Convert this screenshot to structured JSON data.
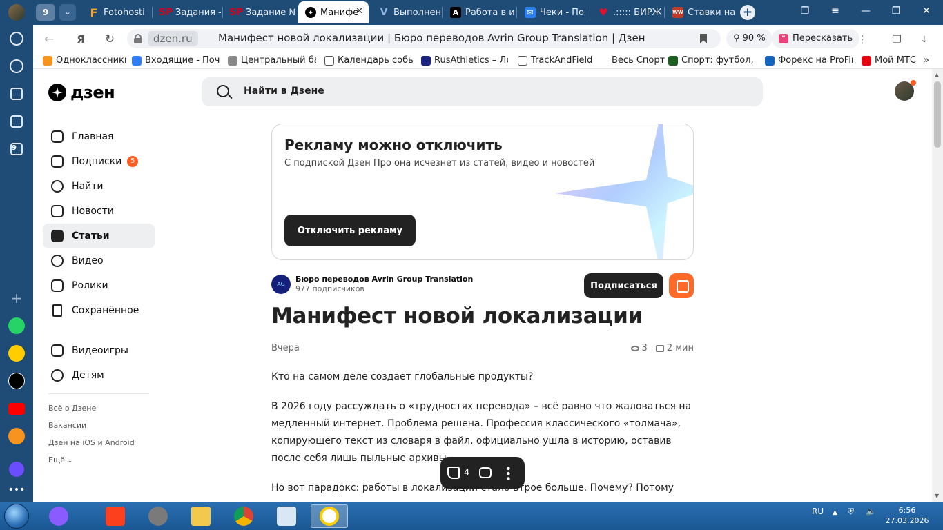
{
  "browser": {
    "tabs": [
      {
        "label": "Fotohosti",
        "icon": "F",
        "color": "#f5a623"
      },
      {
        "label": "Задания -",
        "icon": "SP",
        "color": "#d0021b"
      },
      {
        "label": "Задание №",
        "icon": "SP",
        "color": "#d0021b"
      },
      {
        "label": "Манифе",
        "icon": "дзен",
        "color": "#000000",
        "active": true
      },
      {
        "label": "Выполнен",
        "icon": "V",
        "color": "#3a6ea5"
      },
      {
        "label": "Работа в и",
        "icon": "A",
        "color": "#000000"
      },
      {
        "label": "Чеки - По",
        "icon": "✉",
        "color": "#2d7ff9"
      },
      {
        "label": ".::::: БИРЖ",
        "icon": "♥",
        "color": "#e0102e"
      },
      {
        "label": "Ставки на",
        "icon": "WW",
        "color": "#c0392b"
      }
    ],
    "tab_group_count": "9",
    "url_domain": "dzen.ru",
    "page_title": "Манифест новой локализации | Бюро переводов Avrin Group Translation | Дзен",
    "zoom": "90 %",
    "retell_label": "Пересказать",
    "bookmarks": [
      {
        "label": "Одноклассники",
        "color": "#f7931e"
      },
      {
        "label": "Входящие - Почта",
        "color": "#2d7ff9"
      },
      {
        "label": "Центральный бан",
        "color": "#888888"
      },
      {
        "label": "Календарь событ",
        "color": "#555555"
      },
      {
        "label": "RusAthletics – Лег",
        "color": "#1a237e"
      },
      {
        "label": "TrackAndField",
        "color": "#ffffff"
      },
      {
        "label": "Весь Спорт",
        "color": "#ffffff"
      },
      {
        "label": "Спорт: футбол, хо",
        "color": "#1b5e20"
      },
      {
        "label": "Форекс на ProFina",
        "color": "#1565c0"
      },
      {
        "label": "Мой МТС",
        "color": "#e30611"
      }
    ],
    "bookmarks_more": "»"
  },
  "site": {
    "logo": "дзен",
    "search_placeholder": "Найти в Дзене",
    "nav": [
      {
        "label": "Главная",
        "icon": "home-icon"
      },
      {
        "label": "Подписки",
        "icon": "subscriptions-icon",
        "badge": "5"
      },
      {
        "label": "Найти",
        "icon": "search-icon"
      },
      {
        "label": "Новости",
        "icon": "news-icon"
      },
      {
        "label": "Статьи",
        "icon": "articles-icon",
        "selected": true
      },
      {
        "label": "Видео",
        "icon": "video-icon"
      },
      {
        "label": "Ролики",
        "icon": "shorts-icon"
      },
      {
        "label": "Сохранённое",
        "icon": "bookmark-icon"
      }
    ],
    "nav2": [
      {
        "label": "Видеоигры",
        "icon": "gamepad-icon"
      },
      {
        "label": "Детям",
        "icon": "kids-icon"
      }
    ],
    "footer_links": [
      "Всё о Дзене",
      "Вакансии",
      "Дзен на iOS и Android",
      "Ещё"
    ]
  },
  "ad": {
    "title": "Рекламу можно отключить",
    "subtitle": "С подпиской Дзен Про она исчезнет из статей, видео и новостей",
    "button": "Отключить рекламу"
  },
  "article": {
    "author_avatar": "AG",
    "author_name": "Бюро переводов Avrin Group Translation",
    "author_subs": "977 подписчиков",
    "subscribe_button": "Подписаться",
    "title": "Манифест новой локализации",
    "date": "Вчера",
    "views": "3",
    "read_time": "2 мин",
    "paragraphs": [
      "Кто на самом деле создает глобальные продукты?",
      "В 2026 году рассуждать о «трудностях перевода» – всё равно что жаловаться на медленный интернет. Проблема решена. Профессия классического «толмача», копирующего текст из словаря в файл, официально ушла в историю, оставив после себя лишь пыльные архивы.",
      "Но вот парадокс: работы в локализации стало втрое больше. Почему? Потому что мы"
    ],
    "likes": "4"
  },
  "taskbar": {
    "lang": "RU",
    "time": "6:56",
    "date": "27.03.2026"
  }
}
